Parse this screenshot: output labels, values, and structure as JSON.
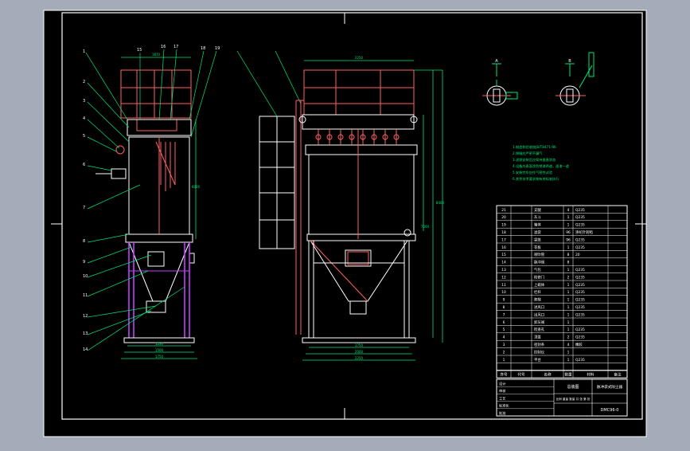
{
  "colors": {
    "backdrop": "#a3acb8",
    "paper": "#000000",
    "frame": "#ffffff",
    "vessel": "#ffffff",
    "rail": "#ff6060",
    "dim": "#00e676",
    "leg": "#c040ff",
    "text": "#ffffff"
  },
  "drawing": {
    "top_dimensions": [
      "1870",
      "2250"
    ],
    "side_dimensions": [
      "6000",
      "7200",
      "8400"
    ],
    "bottom_dimensions_side": [
      "1250",
      "1500",
      "1750"
    ],
    "bottom_dimensions_front": [
      "1750",
      "2000",
      "2250"
    ],
    "detail_a": "A",
    "detail_b": "B"
  },
  "tech_notes": [
    "1.制造和验收按JB/T8471-96",
    "2.焊缝应严密不漏气",
    "3.滤袋安装后应保持垂直状态",
    "4.设备外表面涂防锈漆两道，面漆一道",
    "5.安装完毕应作气密性试验",
    "6.其余技术要求按有关标准执行"
  ],
  "parts_table": {
    "header": {
      "no": "序号",
      "code": "代号",
      "name": "名称",
      "qty": "数量",
      "material": "材料",
      "remark": "备注"
    },
    "rows": [
      {
        "no": "21",
        "name": "支腿",
        "qty": "4",
        "material": "Q235"
      },
      {
        "no": "20",
        "name": "灰斗",
        "qty": "1",
        "material": "Q235"
      },
      {
        "no": "19",
        "name": "箱体",
        "qty": "1",
        "material": "Q235"
      },
      {
        "no": "18",
        "name": "滤袋",
        "qty": "96",
        "material": "涤纶针刺毡"
      },
      {
        "no": "17",
        "name": "袋笼",
        "qty": "96",
        "material": "Q235"
      },
      {
        "no": "16",
        "name": "花板",
        "qty": "1",
        "material": "Q235"
      },
      {
        "no": "15",
        "name": "喷吹管",
        "qty": "8",
        "material": "20"
      },
      {
        "no": "14",
        "name": "脉冲阀",
        "qty": "8",
        "material": ""
      },
      {
        "no": "13",
        "name": "气包",
        "qty": "1",
        "material": "Q235"
      },
      {
        "no": "12",
        "name": "检修门",
        "qty": "2",
        "material": "Q235"
      },
      {
        "no": "11",
        "name": "上箱体",
        "qty": "1",
        "material": "Q235"
      },
      {
        "no": "10",
        "name": "栏杆",
        "qty": "1",
        "material": "Q235"
      },
      {
        "no": "9",
        "name": "爬梯",
        "qty": "1",
        "material": "Q235"
      },
      {
        "no": "8",
        "name": "进风口",
        "qty": "1",
        "material": "Q235"
      },
      {
        "no": "7",
        "name": "出风口",
        "qty": "1",
        "material": "Q235"
      },
      {
        "no": "6",
        "name": "卸灰阀",
        "qty": "1",
        "material": ""
      },
      {
        "no": "5",
        "name": "检查孔",
        "qty": "1",
        "material": "Q235"
      },
      {
        "no": "4",
        "name": "顶盖",
        "qty": "2",
        "material": "Q235"
      },
      {
        "no": "3",
        "name": "密封条",
        "qty": "4",
        "material": "橡胶"
      },
      {
        "no": "2",
        "name": "控制仪",
        "qty": "1",
        "material": ""
      },
      {
        "no": "1",
        "name": "平台",
        "qty": "1",
        "material": "Q235"
      }
    ]
  },
  "title_block": {
    "drawing_title": "脉冲袋式除尘器",
    "assembly_label": "总装图",
    "drawing_number": "DMC96-0",
    "labels": [
      "设计",
      "审核",
      "工艺",
      "标准化",
      "批准"
    ],
    "scale_row": [
      "比例",
      "重量",
      "数量",
      "共",
      "张",
      "第",
      "张"
    ]
  }
}
